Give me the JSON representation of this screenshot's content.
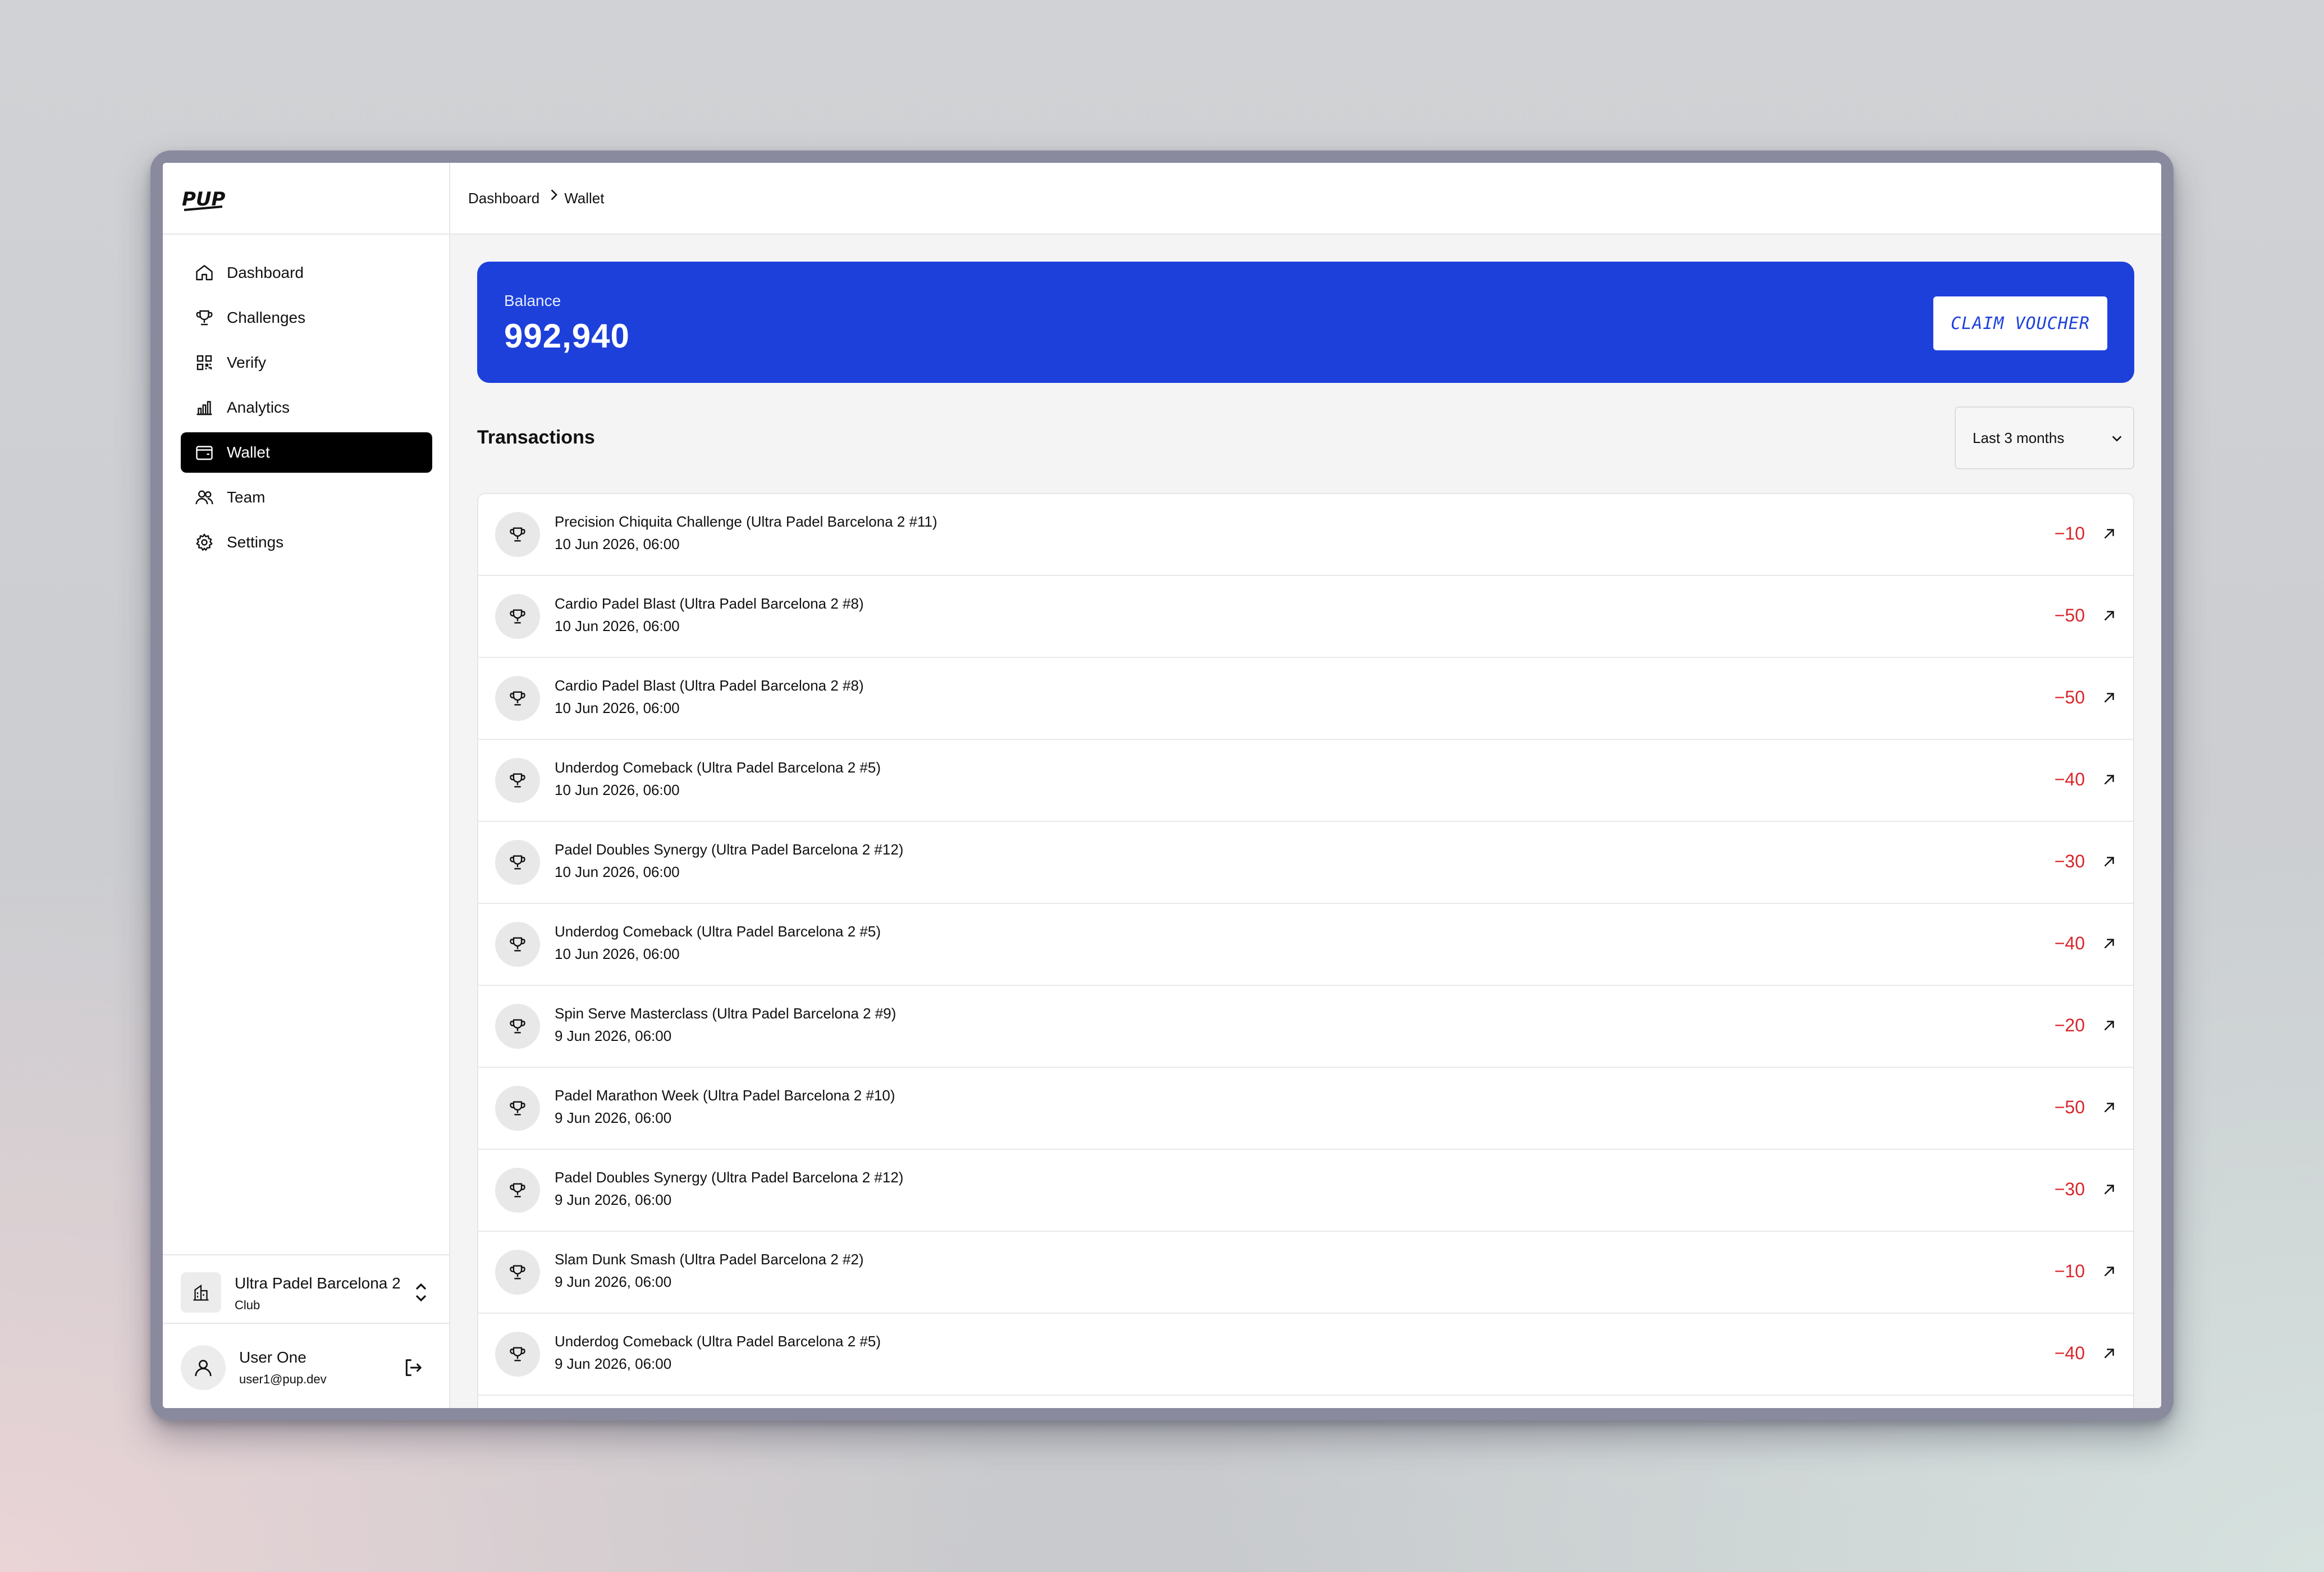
{
  "app": {
    "logo_text": "PUP"
  },
  "breadcrumb": {
    "items": [
      "Dashboard",
      "Wallet"
    ]
  },
  "sidebar": {
    "items": [
      {
        "label": "Dashboard",
        "icon": "home-icon"
      },
      {
        "label": "Challenges",
        "icon": "trophy-icon"
      },
      {
        "label": "Verify",
        "icon": "qr-code-icon"
      },
      {
        "label": "Analytics",
        "icon": "bar-chart-icon"
      },
      {
        "label": "Wallet",
        "icon": "wallet-icon",
        "active": true
      },
      {
        "label": "Team",
        "icon": "users-icon"
      },
      {
        "label": "Settings",
        "icon": "gear-icon"
      }
    ],
    "club": {
      "name": "Ultra Padel Barcelona 2",
      "type": "Club"
    },
    "user": {
      "name": "User One",
      "email": "user1@pup.dev"
    }
  },
  "balance": {
    "label": "Balance",
    "value": "992,940",
    "claim_label": "CLAIM VOUCHER"
  },
  "transactions": {
    "title": "Transactions",
    "period": "Last 3 months",
    "rows": [
      {
        "name": "Precision Chiquita Challenge (Ultra Padel Barcelona 2 #11)",
        "date": "10 Jun 2026, 06:00",
        "amount": "−10"
      },
      {
        "name": "Cardio Padel Blast (Ultra Padel Barcelona 2 #8)",
        "date": "10 Jun 2026, 06:00",
        "amount": "−50"
      },
      {
        "name": "Cardio Padel Blast (Ultra Padel Barcelona 2 #8)",
        "date": "10 Jun 2026, 06:00",
        "amount": "−50"
      },
      {
        "name": "Underdog Comeback (Ultra Padel Barcelona 2 #5)",
        "date": "10 Jun 2026, 06:00",
        "amount": "−40"
      },
      {
        "name": "Padel Doubles Synergy (Ultra Padel Barcelona 2 #12)",
        "date": "10 Jun 2026, 06:00",
        "amount": "−30"
      },
      {
        "name": "Underdog Comeback (Ultra Padel Barcelona 2 #5)",
        "date": "10 Jun 2026, 06:00",
        "amount": "−40"
      },
      {
        "name": "Spin Serve Masterclass (Ultra Padel Barcelona 2 #9)",
        "date": "9 Jun 2026, 06:00",
        "amount": "−20"
      },
      {
        "name": "Padel Marathon Week (Ultra Padel Barcelona 2 #10)",
        "date": "9 Jun 2026, 06:00",
        "amount": "−50"
      },
      {
        "name": "Padel Doubles Synergy (Ultra Padel Barcelona 2 #12)",
        "date": "9 Jun 2026, 06:00",
        "amount": "−30"
      },
      {
        "name": "Slam Dunk Smash (Ultra Padel Barcelona 2 #2)",
        "date": "9 Jun 2026, 06:00",
        "amount": "−10"
      },
      {
        "name": "Underdog Comeback (Ultra Padel Barcelona 2 #5)",
        "date": "9 Jun 2026, 06:00",
        "amount": "−40"
      }
    ]
  },
  "colors": {
    "accent": "#1d40db",
    "negative": "#d8262b",
    "active_nav": "#000000"
  }
}
